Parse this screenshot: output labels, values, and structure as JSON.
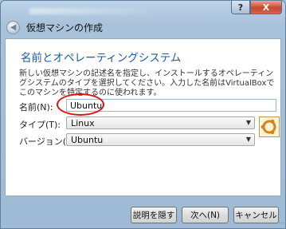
{
  "window": {
    "help_label": "?",
    "close_label": "X"
  },
  "header": {
    "back_icon": "back-arrow-icon",
    "title": "仮想マシンの作成"
  },
  "section": {
    "title": "名前とオペレーティングシステム",
    "description": "新しい仮想マシンの記述名を指定し、インストールするオペレーティングシステムのタイプを選択してください。入力した名前はVirtualBoxでこのマシンを特定するのに使われます。"
  },
  "form": {
    "name_label": "名前(N):",
    "name_value": "Ubuntu",
    "type_label": "タイプ(T):",
    "type_value": "Linux",
    "version_label": "バージョン(V):",
    "version_value": "Ubuntu",
    "os_icon": "ubuntu-logo-icon"
  },
  "buttons": {
    "hide_description": "説明を隠す",
    "next": "次へ(N)",
    "cancel": "キャンセル"
  },
  "colors": {
    "accent_title": "#1c5aa6",
    "annotation_red": "#e01010"
  }
}
